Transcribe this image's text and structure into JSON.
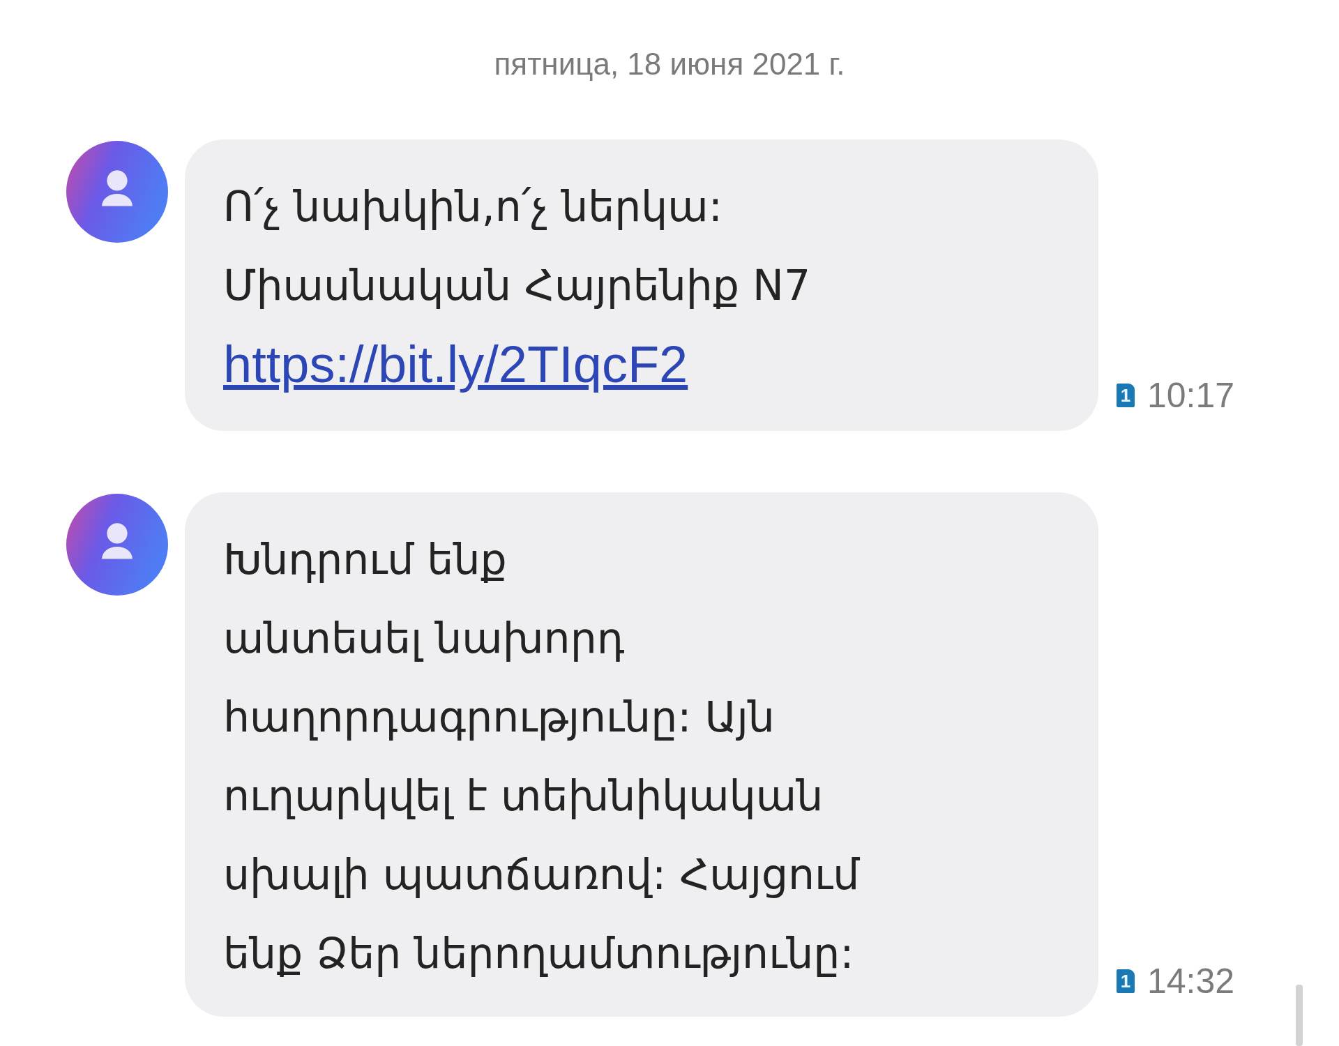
{
  "date_header": "пятница, 18 июня 2021 г.",
  "messages": [
    {
      "parts": [
        {
          "kind": "text",
          "text": "Ո՛չ նախկին,ո՛չ ներկա:\nՄիասնական Հայրենիք N7"
        },
        {
          "kind": "link",
          "text": "https://bit.ly/2TIqcF2"
        }
      ],
      "sim": "1",
      "time": "10:17"
    },
    {
      "parts": [
        {
          "kind": "text",
          "text": "Խնդրում ենք\nանտեսել նախորդ\nհաղորդագրությունը: Այն\nուղարկվել է տեխնիկական\nսխալի պատճառով: Հայցում\nենք Ձեր ներողամտությունը:"
        }
      ],
      "sim": "1",
      "time": "14:32"
    }
  ]
}
